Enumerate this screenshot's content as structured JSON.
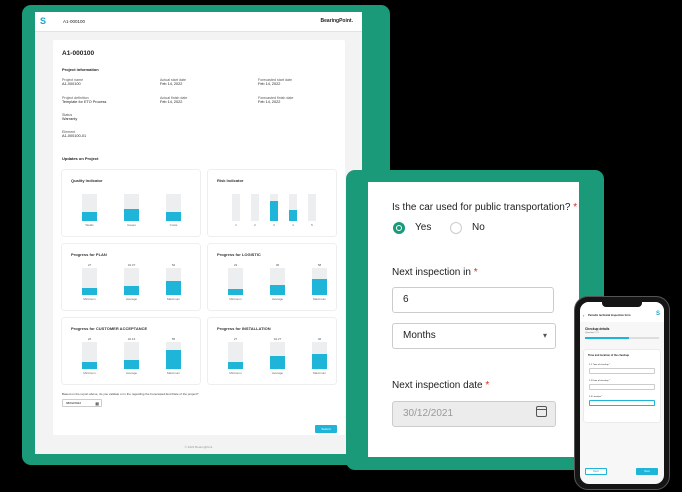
{
  "tablet1": {
    "brand": "S",
    "header_id": "A1-000100",
    "header_logo": "BearingPoint.",
    "title": "A1-000100",
    "project_info_heading": "Project information",
    "fields": [
      {
        "label": "Project name",
        "value": "A1-000100"
      },
      {
        "label": "Actual start date",
        "value": "Feb 14, 2022"
      },
      {
        "label": "Forecasted start date",
        "value": "Feb 14, 2022"
      },
      {
        "label": "Project definition",
        "value": "Template for ETO Process"
      },
      {
        "label": "Actual finish date",
        "value": "Feb 14, 2022"
      },
      {
        "label": "Forecasted finish date",
        "value": "Feb 14, 2022"
      },
      {
        "label": "Status",
        "value": "Warranty"
      },
      {
        "label": "Element",
        "value": "A1-000100-01"
      }
    ],
    "updates_heading": "Updates on Project",
    "quality": {
      "title": "Quality Indicator",
      "labels": [
        "Welds",
        "Issues",
        "Costs"
      ],
      "levels": [
        0.35,
        0.45,
        0.35
      ]
    },
    "risk": {
      "title": "Risk Indicator",
      "labels": [
        "1",
        "2",
        "3",
        "4",
        "5"
      ],
      "levels": [
        0,
        0,
        0.75,
        0.4,
        0
      ]
    },
    "progress_cards": [
      {
        "title": "Progress for PLAN",
        "values": [
          "27",
          "34.37",
          "52"
        ],
        "labels": [
          "Minimum",
          "Average",
          "Maximum"
        ],
        "levels": [
          0.27,
          0.34,
          0.52
        ]
      },
      {
        "title": "Progress for LOGISTIC",
        "values": [
          "23",
          "36",
          "58"
        ],
        "labels": [
          "Minimum",
          "Average",
          "Maximum"
        ],
        "levels": [
          0.23,
          0.36,
          0.58
        ]
      },
      {
        "title": "Progress for CUSTOMER ACCEPTANCE",
        "values": [
          "26",
          "32.16",
          "55"
        ],
        "labels": [
          "Minimum",
          "Average",
          "Maximum"
        ],
        "levels": [
          0.26,
          0.32,
          0.7
        ]
      },
      {
        "title": "Progress for INSTALLATION",
        "values": [
          "27",
          "34.27",
          "46"
        ],
        "labels": [
          "Minimum",
          "Average",
          "Maximum"
        ],
        "levels": [
          0.27,
          0.5,
          0.55
        ]
      }
    ],
    "question": "Based on the report above, do you validate or in the regarding the Forecasted End Date of the project?",
    "date_value": "08/02/2022",
    "submit": "Submit",
    "footer": "© 2022 BearingPoint"
  },
  "tablet2": {
    "q1": "Is the car used for public transportation?",
    "req": "*",
    "yes": "Yes",
    "no": "No",
    "q2": "Next inspection in",
    "inspection_value": "6",
    "unit_value": "Months",
    "q3": "Next inspection date",
    "date_value": "30/12/2021"
  },
  "phone": {
    "title": "Periodic technical inspection form",
    "section": "Checkup details",
    "step": "Question 1 / 3",
    "progress": 0.6,
    "subheading": "Time and location of the checkup",
    "field1": "1.1 Time of checkup *",
    "field2": "1.2 Date of checkup *",
    "field3": "1.3 Location *",
    "back": "Back",
    "next": "Next"
  }
}
